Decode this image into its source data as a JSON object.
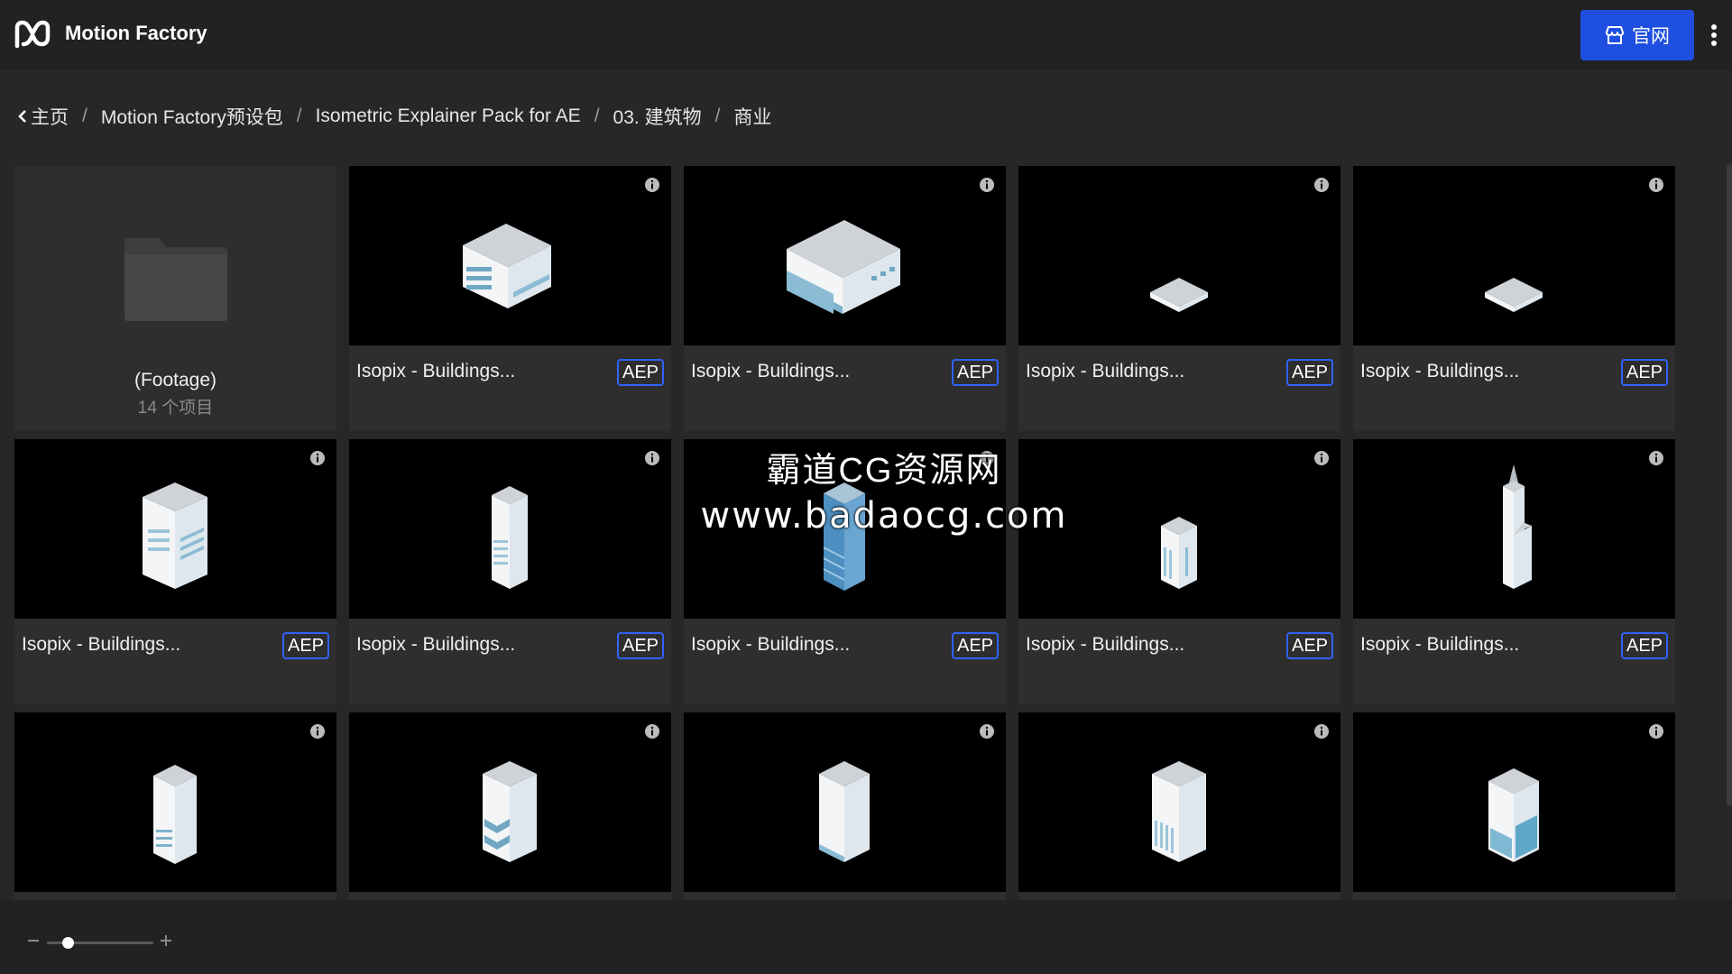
{
  "app": {
    "title": "Motion Factory",
    "site_button": "官网"
  },
  "breadcrumb": [
    "主页",
    "Motion Factory预设包",
    "Isometric Explainer Pack for AE",
    "03. 建筑物",
    "商业"
  ],
  "folder": {
    "name": "(Footage)",
    "count": "14 个项目"
  },
  "items": [
    {
      "name": "Isopix - Buildings...",
      "tag": "AEP",
      "icon": "office-building-wide"
    },
    {
      "name": "Isopix - Buildings...",
      "tag": "AEP",
      "icon": "warehouse-building"
    },
    {
      "name": "Isopix - Buildings...",
      "tag": "AEP",
      "icon": "flat-plot"
    },
    {
      "name": "Isopix - Buildings...",
      "tag": "AEP",
      "icon": "flat-plot"
    },
    {
      "name": "Isopix - Buildings...",
      "tag": "AEP",
      "icon": "office-block"
    },
    {
      "name": "Isopix - Buildings...",
      "tag": "AEP",
      "icon": "narrow-tower"
    },
    {
      "name": "Isopix - Buildings...",
      "tag": "AEP",
      "icon": "glass-tower"
    },
    {
      "name": "Isopix - Buildings...",
      "tag": "AEP",
      "icon": "small-tower"
    },
    {
      "name": "Isopix - Buildings...",
      "tag": "AEP",
      "icon": "spire-skyscraper"
    },
    {
      "name": "",
      "tag": "",
      "icon": "tower-striped"
    },
    {
      "name": "",
      "tag": "",
      "icon": "tower-chevron"
    },
    {
      "name": "",
      "tag": "",
      "icon": "tower-plain"
    },
    {
      "name": "",
      "tag": "",
      "icon": "tower-grid"
    },
    {
      "name": "",
      "tag": "",
      "icon": "tower-glass-base"
    }
  ],
  "watermark": {
    "line1": "霸道CG资源网",
    "line2": "www.badaocg.com"
  },
  "zoom": {
    "level": 0.2
  },
  "colors": {
    "accent": "#1f4fe0",
    "tag_border": "#2f63ff",
    "background": "#272727"
  }
}
